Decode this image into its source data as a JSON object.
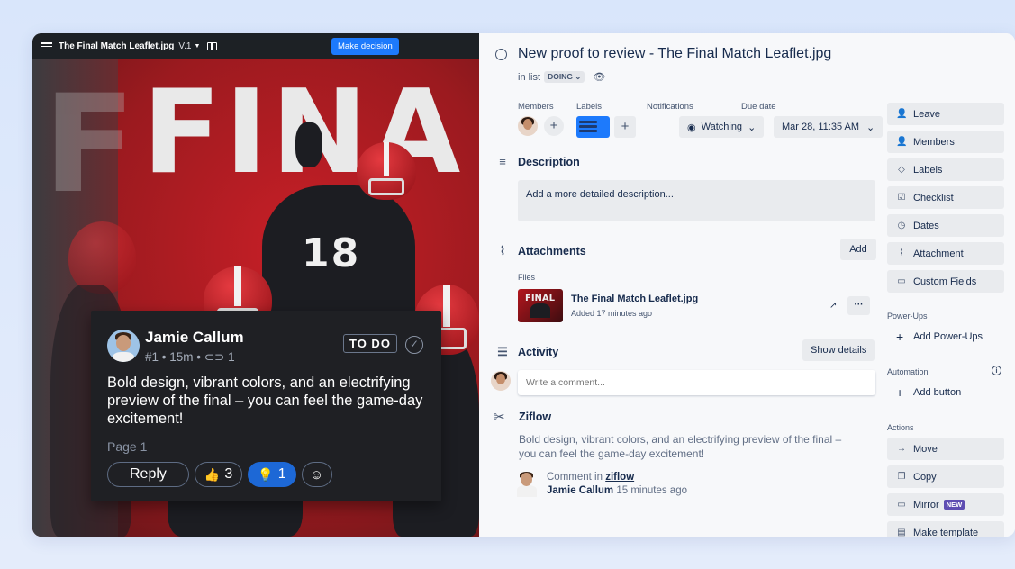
{
  "viewer": {
    "file_title": "The Final Match Leaflet.jpg",
    "version": "V.1",
    "decision_button": "Make decision",
    "poster_word": "FINA",
    "jersey_number": "18"
  },
  "comment_card": {
    "author": "Jamie Callum",
    "meta": "#1 • 15m • ",
    "attachments_count": "1",
    "status": "TO DO",
    "text": "Bold design, vibrant colors, and an electrifying preview of the final – you can feel the game-day excitement!",
    "page": "Page 1",
    "reply_label": "Reply",
    "thumbs_count": "3",
    "idea_count": "1"
  },
  "card": {
    "title": "New proof to review - The Final Match Leaflet.jpg",
    "in_list_prefix": "in list",
    "list_name": "DOING",
    "members_label": "Members",
    "labels_label": "Labels",
    "notifications_label": "Notifications",
    "watching_label": "Watching",
    "due_label": "Due date",
    "due_value": "Mar 28, 11:35 AM",
    "description_heading": "Description",
    "description_placeholder": "Add a more detailed description...",
    "attachments_heading": "Attachments",
    "add_label": "Add",
    "files_label": "Files",
    "file_name": "The Final Match Leaflet.jpg",
    "file_added": "Added 17 minutes ago",
    "thumb_text": "FINAL",
    "activity_heading": "Activity",
    "show_details": "Show details",
    "comment_placeholder": "Write a comment...",
    "ziflow_name": "Ziflow",
    "ziflow_text": "Bold design, vibrant colors, and an electrifying preview of the final – you can feel the game-day excitement!",
    "comment_in_prefix": "Comment in",
    "comment_in_link": "ziflow",
    "comment_author": "Jamie Callum",
    "comment_time": "15 minutes ago"
  },
  "sidebar": {
    "leave": "Leave",
    "members": "Members",
    "labels": "Labels",
    "checklist": "Checklist",
    "dates": "Dates",
    "attachment": "Attachment",
    "custom_fields": "Custom Fields",
    "powerups_heading": "Power-Ups",
    "add_powerups": "Add Power-Ups",
    "automation_heading": "Automation",
    "add_button": "Add button",
    "actions_heading": "Actions",
    "move": "Move",
    "copy": "Copy",
    "mirror": "Mirror",
    "new_badge": "NEW",
    "make_template": "Make template"
  },
  "colors": {
    "accent_blue": "#1d7afc",
    "poster_red": "#c81f27",
    "new_badge": "#5e4db2"
  },
  "icons": [
    "menu-icon",
    "book-icon",
    "check-circle-icon",
    "thumbs-up-icon",
    "lightbulb-icon",
    "add-emoji-icon",
    "eye-icon",
    "paperclip-icon",
    "description-icon",
    "activity-icon",
    "ziflow-icon",
    "info-icon"
  ]
}
